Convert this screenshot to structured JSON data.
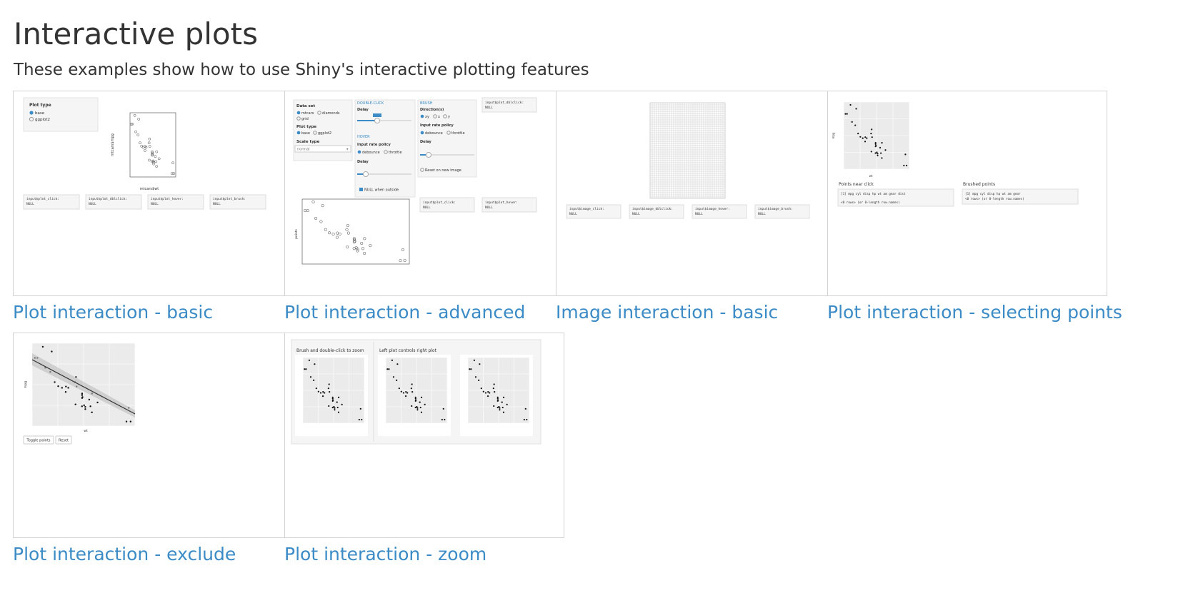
{
  "page": {
    "title": "Interactive plots",
    "subtitle": "These examples show how to use Shiny's interactive plotting features"
  },
  "cards": [
    {
      "label": "Plot interaction - basic"
    },
    {
      "label": "Plot interaction - advanced"
    },
    {
      "label": "Image interaction - basic"
    },
    {
      "label": "Plot interaction - selecting points"
    },
    {
      "label": "Plot interaction - exclude"
    },
    {
      "label": "Plot interaction - zoom"
    }
  ],
  "thumbnails": {
    "basic": {
      "panel_title": "Plot type",
      "options": [
        "base",
        "ggplot2"
      ],
      "xlabel": "mtcars$wt",
      "ylabel": "mtcars$mpg",
      "outputs": [
        "input$plot_click:",
        "input$plot_dblclick:",
        "input$plot_hover:",
        "input$plot_brush:"
      ],
      "null_text": "NULL"
    },
    "advanced": {
      "dataset_label": "Data set",
      "datasets": [
        "mtcars",
        "diamonds",
        "grid"
      ],
      "plot_type_label": "Plot type",
      "plot_types": [
        "base",
        "ggplot2"
      ],
      "scale_label": "Scale type",
      "scale_value": "normal",
      "dblclick_header": "DOUBLE-CLICK",
      "delay_label": "Delay",
      "hover_header": "HOVER",
      "rate_label": "Input rate policy",
      "rates": [
        "debounce",
        "throttle"
      ],
      "null_outside": "NULL when outside",
      "brush_header": "BRUSH",
      "directions_label": "Direction(s)",
      "directions": [
        "xy",
        "x",
        "y"
      ],
      "reset_label": "Reset on new image",
      "dblclick_out": "input$plot_dblclick:",
      "click_out": "input$plot_click:",
      "hover_out": "input$plot_hover:",
      "null_text": "NULL",
      "ylabel": "points"
    },
    "image": {
      "outputs": [
        "input$image_click:",
        "input$image_dblclick:",
        "input$image_hover:",
        "input$image_brush:"
      ],
      "null_text": "NULL"
    },
    "selecting": {
      "near_label": "Points near click",
      "brushed_label": "Brushed points",
      "near_text": "[1] mpg  cyl  disp  hp  wt  am  gear  dist",
      "near_text2": "<0 rows> (or 0-length row.names)",
      "brushed_text": "[1] mpg  cyl  disp  hp  wt  am  gear",
      "brushed_text2": "<0 rows> (or 0-length row.names)",
      "xlabel": "wt",
      "ylabel": "mpg"
    },
    "exclude": {
      "toggle_label": "Toggle points",
      "reset_label": "Reset",
      "xlabel": "wt",
      "ylabel": "mpg"
    },
    "zoom": {
      "left_title": "Brush and double-click to zoom",
      "right_title": "Left plot controls right plot",
      "xlabel": "wt",
      "ylabel": "mpg"
    }
  },
  "colors": {
    "link": "#3a8bc6",
    "title": "#333333",
    "border": "#d3d3d3"
  }
}
